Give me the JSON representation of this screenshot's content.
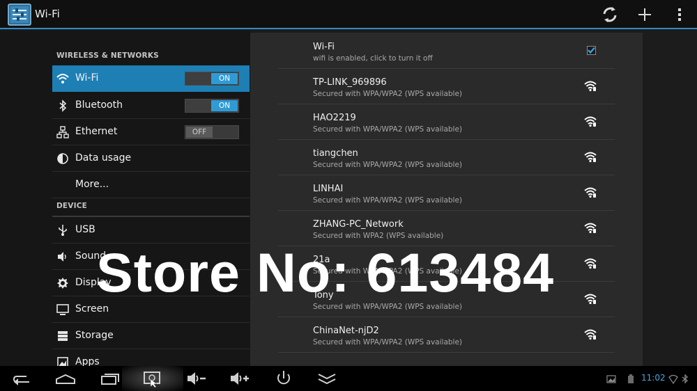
{
  "actionbar": {
    "title": "Wi-Fi"
  },
  "icons": {
    "app": "settings-icon",
    "refresh": "refresh-icon",
    "add": "plus-icon",
    "overflow": "overflow-menu-icon"
  },
  "colors": {
    "accent": "#2f9bd6",
    "selected": "#1e7fb5",
    "clock": "#49a7e0"
  },
  "settings": {
    "section_wireless": "WIRELESS & NETWORKS",
    "section_device": "DEVICE",
    "wifi": {
      "label": "Wi-Fi",
      "toggle": "ON"
    },
    "bluetooth": {
      "label": "Bluetooth",
      "toggle": "ON"
    },
    "ethernet": {
      "label": "Ethernet",
      "toggle": "OFF"
    },
    "data_usage": {
      "label": "Data usage"
    },
    "more": {
      "label": "More..."
    },
    "usb": {
      "label": "USB"
    },
    "sound": {
      "label": "Sound"
    },
    "display": {
      "label": "Display"
    },
    "screen": {
      "label": "Screen"
    },
    "storage": {
      "label": "Storage"
    },
    "apps": {
      "label": "Apps"
    }
  },
  "wifi_pane": {
    "header": {
      "title": "Wi-Fi",
      "subtitle": "wifi is enabled, click to turn it off",
      "checked": true
    },
    "networks": [
      {
        "name": "TP-LINK_969896",
        "security": "Secured with WPA/WPA2 (WPS available)"
      },
      {
        "name": "HAO2219",
        "security": "Secured with WPA/WPA2 (WPS available)"
      },
      {
        "name": "tiangchen",
        "security": "Secured with WPA/WPA2 (WPS available)"
      },
      {
        "name": "LINHAI",
        "security": "Secured with WPA/WPA2 (WPS available)"
      },
      {
        "name": "ZHANG-PC_Network",
        "security": "Secured with WPA2 (WPS available)"
      },
      {
        "name": "21a",
        "security": "Secured with WPA/WPA2 (WPS available)"
      },
      {
        "name": "Tony",
        "security": "Secured with WPA/WPA2 (WPS available)"
      },
      {
        "name": "ChinaNet-njD2",
        "security": "Secured with WPA/WPA2 (WPS available)"
      }
    ]
  },
  "watermark": "Store No: 613484",
  "statusbar": {
    "time": "11:02"
  }
}
